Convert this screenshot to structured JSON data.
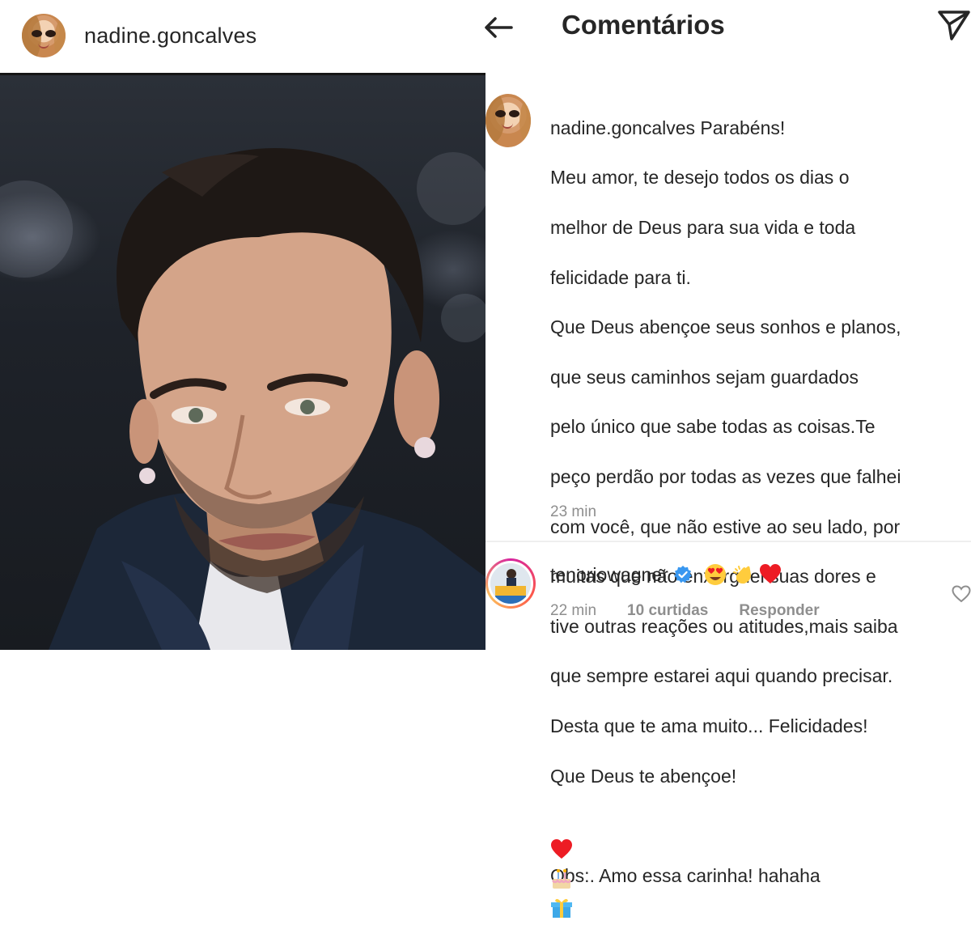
{
  "post": {
    "username": "nadine.goncalves",
    "image": {
      "description_icon": "portrait-photo"
    }
  },
  "comments_screen": {
    "title": "Comentários",
    "back_icon": "back-arrow-icon",
    "send_icon": "send-icon",
    "main_comment": {
      "username": "nadine.goncalves",
      "first_line_text": "Parabéns!",
      "lines": [
        "Meu amor, te desejo todos os dias o",
        "melhor de Deus para sua vida e toda",
        "felicidade para ti.",
        "Que Deus abençoe seus sonhos e planos,",
        "que seus caminhos sejam guardados",
        "pelo único que sabe todas as coisas.Te",
        "peço perdão por todas as vezes que falhei",
        "com você, que não estive ao seu lado, por",
        "muitas que não enxerguei suas dores e",
        "tive outras reações ou atitudes,mais saiba",
        "que sempre estarei aqui quando precisar.",
        "Desta que te ama muito... Felicidades!",
        "Que Deus te abençoe!"
      ],
      "emojis": [
        "heart",
        "birthday-cake",
        "gift"
      ],
      "last_line": "Obs:. Amo essa carinha! hahaha",
      "time": "23 min"
    },
    "reply_comment": {
      "username": "tenoriowagner",
      "verified": true,
      "emojis": [
        "heart-eyes",
        "clapping-hands",
        "heart"
      ],
      "time": "22 min",
      "likes": "10 curtidas",
      "reply_label": "Responder"
    }
  },
  "colors": {
    "text": "#262626",
    "muted": "#8e8e8e",
    "verified_blue": "#3897f0",
    "heart_red": "#ed1c24"
  }
}
